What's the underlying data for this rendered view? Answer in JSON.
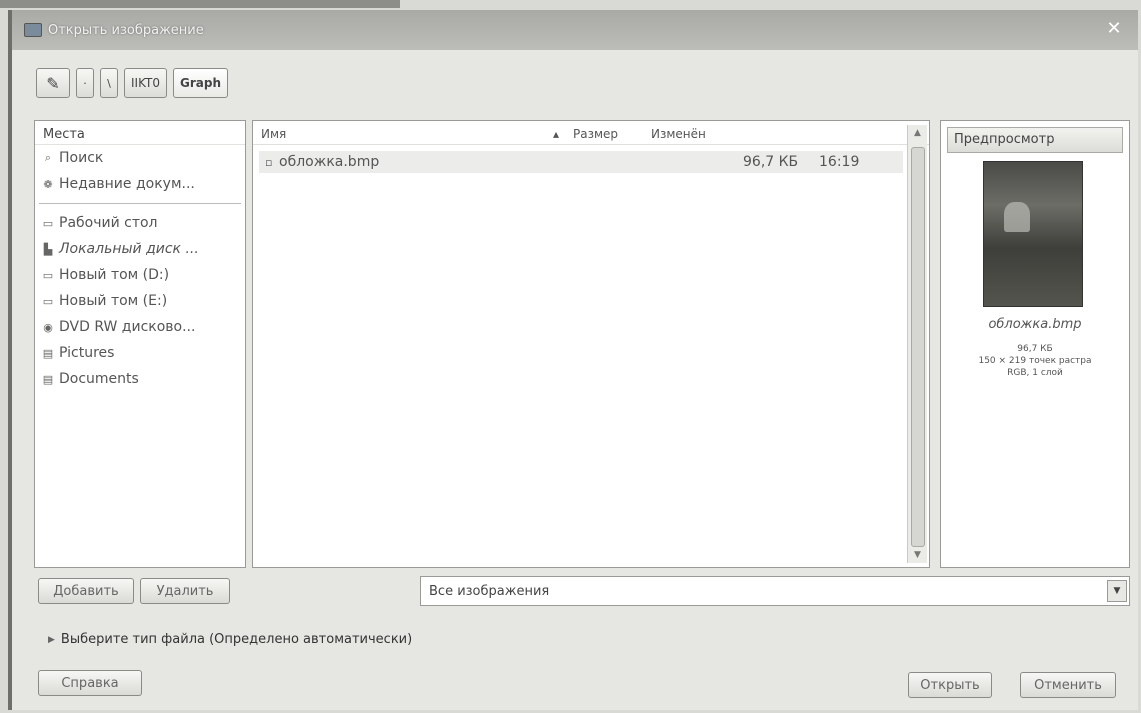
{
  "window": {
    "title": "Открыть изображение"
  },
  "pathbar": {
    "items": [
      "·",
      "\\",
      "IIKT0",
      "Graph"
    ]
  },
  "places": {
    "header": "Места",
    "items": [
      {
        "label": "Поиск",
        "icon": "search-icon"
      },
      {
        "label": "Недавние докум...",
        "icon": "recent-icon"
      },
      {
        "label": "Рабочий стол",
        "icon": "desktop-icon"
      },
      {
        "label": "Локальный диск ...",
        "icon": "disk-icon"
      },
      {
        "label": "Новый том (D:)",
        "icon": "drive-icon"
      },
      {
        "label": "Новый том (E:)",
        "icon": "drive-icon"
      },
      {
        "label": "DVD RW дисково...",
        "icon": "dvd-icon"
      },
      {
        "label": "Pictures",
        "icon": "folder-icon"
      },
      {
        "label": "Documents",
        "icon": "folder-icon"
      }
    ]
  },
  "files": {
    "columns": {
      "name": "Имя",
      "size": "Размер",
      "modified": "Изменён"
    },
    "rows": [
      {
        "name": "обложка.bmp",
        "size": "96,7 КБ",
        "modified": "16:19"
      }
    ]
  },
  "preview": {
    "header": "Предпросмотр",
    "filename": "обложка.bmp",
    "info_size": "96,7 КБ",
    "info_dims": "150 × 219 точек растра",
    "info_mode": "RGB, 1 слой"
  },
  "buttons": {
    "add": "Добавить",
    "remove": "Удалить",
    "help": "Справка",
    "open": "Открыть",
    "cancel": "Отменить"
  },
  "filter": {
    "value": "Все изображения"
  },
  "filetype": {
    "label": "Выберите тип файла (Определено автоматически)"
  }
}
